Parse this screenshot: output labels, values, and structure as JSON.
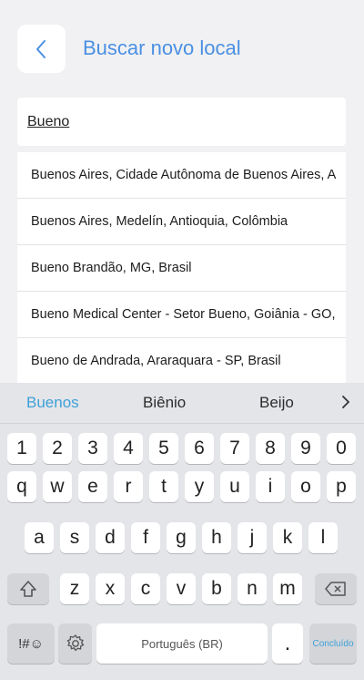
{
  "header": {
    "title": "Buscar novo local"
  },
  "search": {
    "value": "Bueno"
  },
  "results": [
    "Buenos Aires, Cidade Autônoma de Buenos Aires, A",
    "Buenos Aires, Medelín, Antioquia, Colômbia",
    "Bueno Brandão, MG, Brasil",
    "Bueno Medical Center - Setor Bueno, Goiânia - GO,",
    "Bueno de Andrada, Araraquara - SP, Brasil"
  ],
  "keyboard": {
    "suggestions": [
      "Buenos",
      "Biênio",
      "Beijo"
    ],
    "row_numbers": [
      "1",
      "2",
      "3",
      "4",
      "5",
      "6",
      "7",
      "8",
      "9",
      "0"
    ],
    "row1": [
      "q",
      "w",
      "e",
      "r",
      "t",
      "y",
      "u",
      "i",
      "o",
      "p"
    ],
    "row2": [
      "a",
      "s",
      "d",
      "f",
      "g",
      "h",
      "j",
      "k",
      "l"
    ],
    "row3": [
      "z",
      "x",
      "c",
      "v",
      "b",
      "n",
      "m"
    ],
    "symbols_label": "!#☺",
    "space_label": "Português (BR)",
    "period_label": ".",
    "done_label": "Concluído"
  },
  "colors": {
    "accent": "#4a90e2",
    "keyboard_accent": "#3ea0d8"
  }
}
